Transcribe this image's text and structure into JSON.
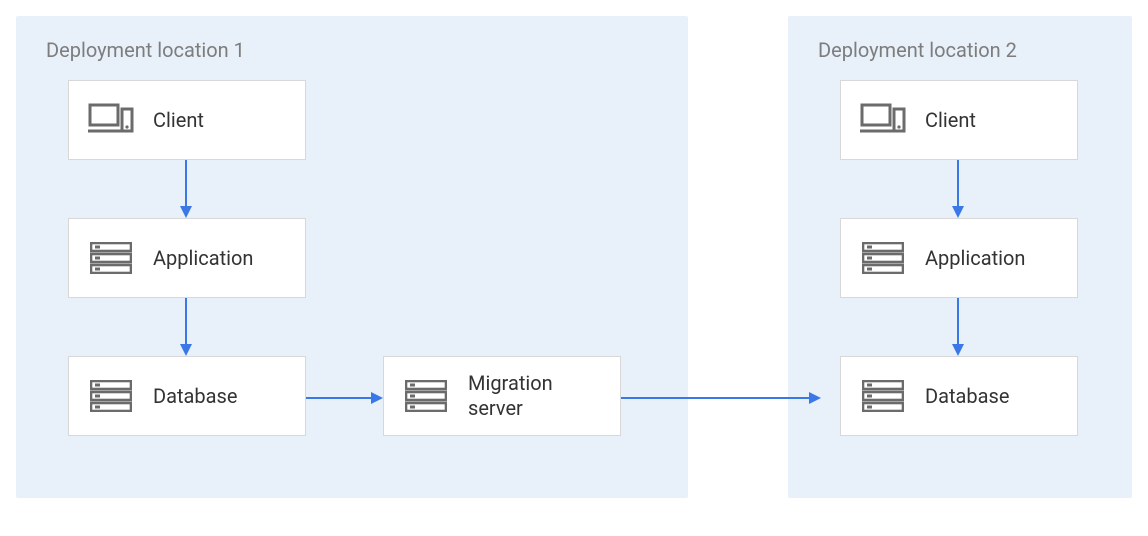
{
  "diagram": {
    "location1": {
      "title": "Deployment location 1",
      "nodes": {
        "client": "Client",
        "application": "Application",
        "database": "Database",
        "migration": "Migration server"
      }
    },
    "location2": {
      "title": "Deployment location 2",
      "nodes": {
        "client": "Client",
        "application": "Application",
        "database": "Database"
      }
    },
    "arrows": [
      {
        "from": "loc1.client",
        "to": "loc1.application"
      },
      {
        "from": "loc1.application",
        "to": "loc1.database"
      },
      {
        "from": "loc1.database",
        "to": "loc1.migration"
      },
      {
        "from": "loc1.migration",
        "to": "loc2.database"
      },
      {
        "from": "loc2.client",
        "to": "loc2.application"
      },
      {
        "from": "loc2.application",
        "to": "loc2.database"
      }
    ],
    "colors": {
      "panel_bg": "#e8f0fa",
      "arrow": "#3b78e7",
      "node_border": "#d8d8d8",
      "title_text": "#7d7d7d"
    }
  }
}
